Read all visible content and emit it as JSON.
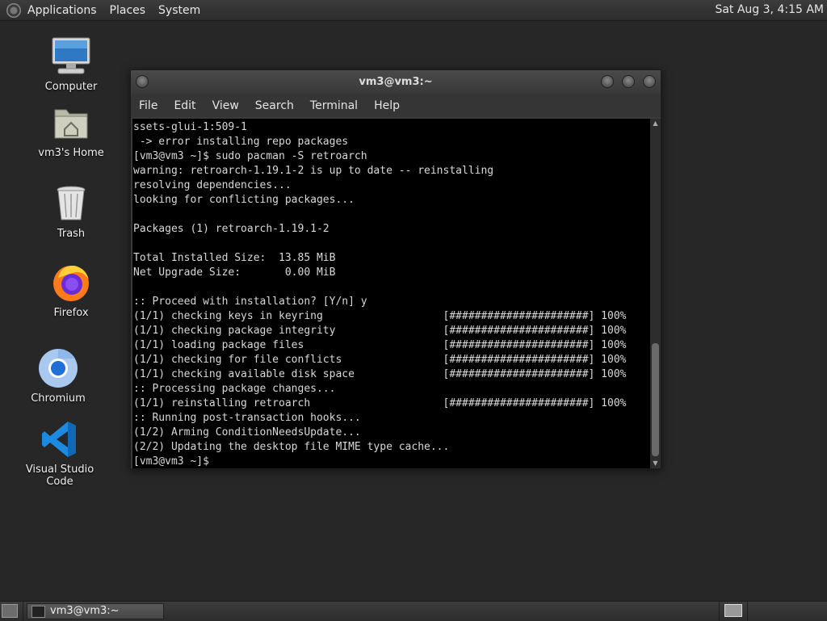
{
  "top_panel": {
    "menus": [
      "Applications",
      "Places",
      "System"
    ],
    "clock": "Sat Aug  3, 4:15 AM"
  },
  "desktop_icons": [
    {
      "label": "Computer",
      "icon": "computer-icon"
    },
    {
      "label": "vm3's Home",
      "icon": "home-folder-icon"
    },
    {
      "label": "Trash",
      "icon": "trash-icon"
    },
    {
      "label": "Firefox",
      "icon": "firefox-icon"
    },
    {
      "label": "Chromium",
      "icon": "chromium-icon"
    },
    {
      "label": "Visual Studio Code",
      "icon": "vscode-icon"
    }
  ],
  "terminal": {
    "title": "vm3@vm3:~",
    "menu": [
      "File",
      "Edit",
      "View",
      "Search",
      "Terminal",
      "Help"
    ],
    "lines": [
      "ssets-glui-1:509-1",
      " -> error installing repo packages",
      "[vm3@vm3 ~]$ sudo pacman -S retroarch",
      "warning: retroarch-1.19.1-2 is up to date -- reinstalling",
      "resolving dependencies...",
      "looking for conflicting packages...",
      "",
      "Packages (1) retroarch-1.19.1-2",
      "",
      "Total Installed Size:  13.85 MiB",
      "Net Upgrade Size:       0.00 MiB",
      "",
      ":: Proceed with installation? [Y/n] y",
      "(1/1) checking keys in keyring                   [######################] 100%",
      "(1/1) checking package integrity                 [######################] 100%",
      "(1/1) loading package files                      [######################] 100%",
      "(1/1) checking for file conflicts                [######################] 100%",
      "(1/1) checking available disk space              [######################] 100%",
      ":: Processing package changes...",
      "(1/1) reinstalling retroarch                     [######################] 100%",
      ":: Running post-transaction hooks...",
      "(1/2) Arming ConditionNeedsUpdate...",
      "(2/2) Updating the desktop file MIME type cache...",
      "[vm3@vm3 ~]$ "
    ]
  },
  "bottom_panel": {
    "task_label": "vm3@vm3:~"
  }
}
